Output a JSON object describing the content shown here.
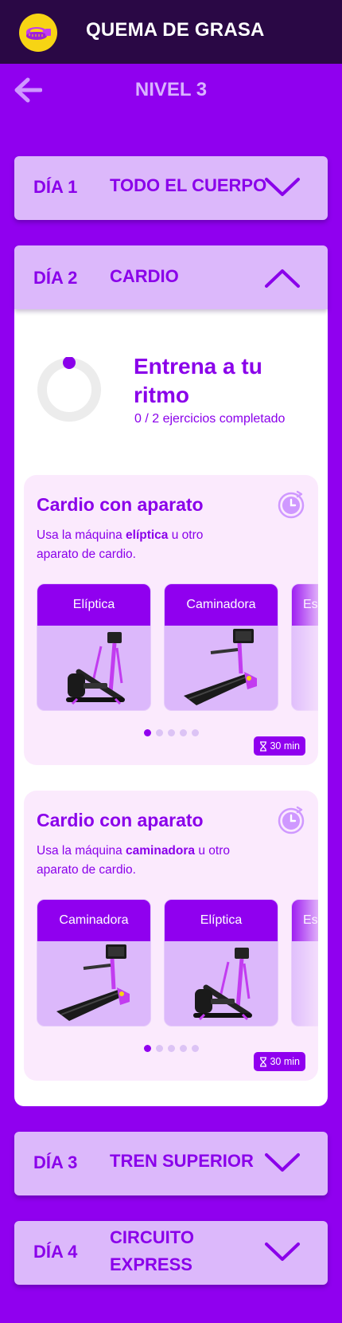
{
  "header": {
    "title": "QUEMA DE GRASA",
    "logo_icon": "measuring-tape-icon"
  },
  "nav": {
    "back_icon": "arrow-left-icon",
    "level_title": "NIVEL 3"
  },
  "colors": {
    "brand_purple": "#9000ef",
    "header_bg": "#2a0845",
    "card_lilac": "#dcb8fb",
    "logo_yellow": "#f7d414"
  },
  "days": [
    {
      "day": "DÍA 1",
      "name": "TODO EL CUERPO",
      "expanded": false
    },
    {
      "day": "DÍA 2",
      "name": "CARDIO",
      "expanded": true
    },
    {
      "day": "DÍA 3",
      "name": "TREN SUPERIOR",
      "expanded": false
    },
    {
      "day": "DÍA 4",
      "name": "CIRCUITO EXPRESS",
      "expanded": false
    }
  ],
  "progress": {
    "title": "Entrena a tu ritmo",
    "subtitle": "0 / 2 ejercicios completado",
    "completed": 0,
    "total": 2
  },
  "exercises": [
    {
      "title": "Cardio con aparato",
      "desc_prefix": "Usa la máquina ",
      "desc_bold": "elíptica",
      "desc_suffix": " u otro aparato de cardio.",
      "machines": [
        "Elíptica",
        "Caminadora",
        "Es"
      ],
      "machine_icons": [
        "elliptical-machine-icon",
        "treadmill-icon"
      ],
      "dots_total": 5,
      "dot_active": 0,
      "duration": "30 min"
    },
    {
      "title": "Cardio con aparato",
      "desc_prefix": "Usa la máquina ",
      "desc_bold": "caminadora",
      "desc_suffix": " u otro aparato de cardio.",
      "machines": [
        "Caminadora",
        "Elíptica",
        "Es"
      ],
      "machine_icons": [
        "treadmill-icon",
        "elliptical-machine-icon"
      ],
      "dots_total": 5,
      "dot_active": 0,
      "duration": "30 min"
    }
  ]
}
